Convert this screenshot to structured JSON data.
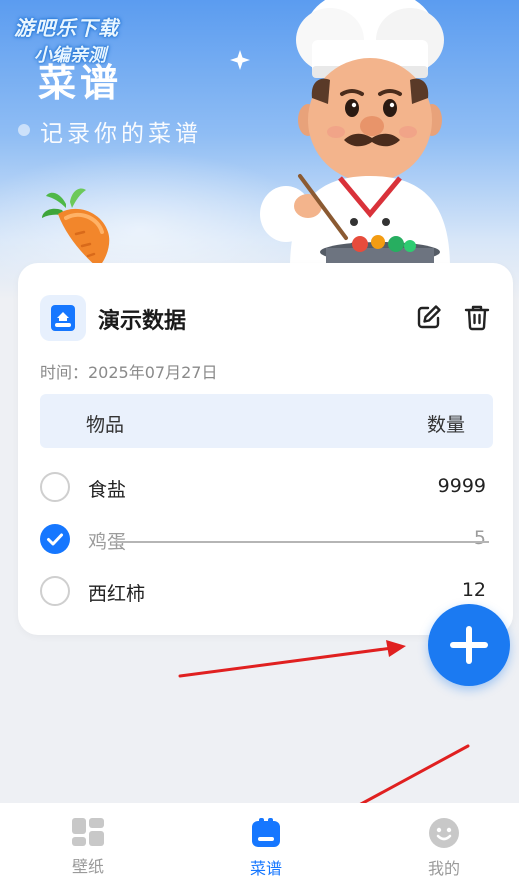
{
  "watermark": {
    "line1": "游吧乐下载",
    "line2": "小编亲测"
  },
  "hero": {
    "title": "菜谱",
    "subtitle": "记录你的菜谱",
    "decorations": [
      "sparkle-icon",
      "carrot-illustration",
      "chef-illustration"
    ]
  },
  "recipe_card": {
    "icon": "book-icon",
    "title": "演示数据",
    "edit_icon": "edit-icon",
    "delete_icon": "trash-icon",
    "time": "时间：2025年07月27日",
    "table": {
      "columns": [
        "物品",
        "数量"
      ],
      "rows": [
        {
          "name": "食盐",
          "quantity": "9999",
          "checked": false
        },
        {
          "name": "鸡蛋",
          "quantity": "5",
          "checked": true
        },
        {
          "name": "西红柿",
          "quantity": "12",
          "checked": false
        }
      ]
    }
  },
  "fab": {
    "icon": "plus-icon"
  },
  "tabbar": {
    "active": "菜谱",
    "tabs": [
      {
        "label": "壁纸",
        "icon": "grid-icon"
      },
      {
        "label": "菜谱",
        "icon": "recipe-book-icon"
      },
      {
        "label": "我的",
        "icon": "smiley-icon"
      }
    ]
  },
  "colors": {
    "accent": "#1677ff",
    "fab": "#1b7af2",
    "annotation_arrow": "#e02020",
    "hero_gradient_top": "#5b9cf0"
  }
}
